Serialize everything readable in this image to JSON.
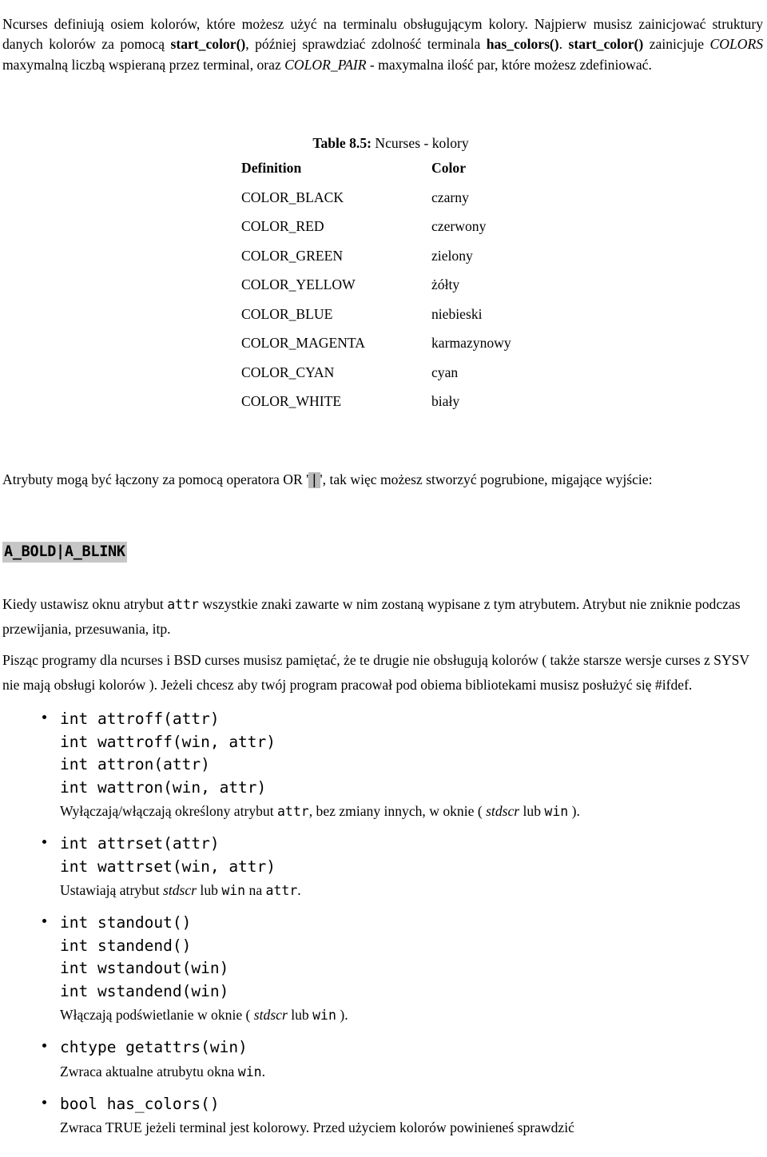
{
  "document": {
    "language": "pl",
    "intro": {
      "segments": [
        {
          "type": "text",
          "text": "Ncurses definiują osiem kolorów, które możesz użyć na terminalu obsługującym kolory. Najpierw musisz zainicjować struktury danych kolorów za pomocą "
        },
        {
          "type": "bold",
          "text": "start_color()"
        },
        {
          "type": "text",
          "text": ", później sprawdziać zdolność terminala "
        },
        {
          "type": "bold",
          "text": "has_colors()"
        },
        {
          "type": "text",
          "text": ". "
        },
        {
          "type": "bold",
          "text": "start_color()"
        },
        {
          "type": "text",
          "text": " zainicjuje "
        },
        {
          "type": "italic",
          "text": "COLORS"
        },
        {
          "type": "text",
          "text": " maxymalną liczbą wspieraną przez terminal, oraz "
        },
        {
          "type": "italic",
          "text": "COLOR_PAIR"
        },
        {
          "type": "text",
          "text": " - maxymalna ilość par, które możesz zdefiniować."
        }
      ],
      "plain": "Ncurses definiują osiem kolorów, które możesz użyć na terminalu obsługującym kolory. Najpierw musisz zainicjować struktury danych kolorów za pomocą start_color(), później sprawdziać zdolność terminala has_colors(). start_color() zainicjuje COLORS maxymalną liczbą wspieraną przez terminal, oraz COLOR_PAIR - maxymalna ilość par, które możesz zdefiniować."
    },
    "table": {
      "caption_label": "Table 8.5:",
      "caption_text": "Ncurses - kolory",
      "headers": {
        "definition": "Definition",
        "color": "Color"
      },
      "rows": [
        {
          "definition": "COLOR_BLACK",
          "color": "czarny"
        },
        {
          "definition": "COLOR_RED",
          "color": "czerwony"
        },
        {
          "definition": "COLOR_GREEN",
          "color": "zielony"
        },
        {
          "definition": "COLOR_YELLOW",
          "color": "żółty"
        },
        {
          "definition": "COLOR_BLUE",
          "color": "niebieski"
        },
        {
          "definition": "COLOR_MAGENTA",
          "color": "karmazynowy"
        },
        {
          "definition": "COLOR_CYAN",
          "color": "cyan"
        },
        {
          "definition": "COLOR_WHITE",
          "color": "biały"
        }
      ]
    },
    "or_paragraph": {
      "before": "Atrybuty mogą być łączony za pomocą operatora OR '",
      "pipe": "|",
      "after": "', tak więc możesz stworzyć pogrubione, migające wyjście:"
    },
    "code_block": {
      "text": "A_BOLD|A_BLINK",
      "background": "#c6c6c6"
    },
    "attr_paragraph": {
      "part1": "Kiedy ustawisz oknu atrybut ",
      "mono1": "attr",
      "part2": " wszystkie znaki zawarte w nim zostaną wypisane z tym atrybutem. Atrybut nie zniknie podczas przewijania, przesuwania, itp."
    },
    "bsd_paragraph": {
      "text": "Pisząc programy dla ncurses i BSD curses musisz pamiętać, że te drugie nie obsługują kolorów ( także starsze wersje curses z SYSV nie mają obsługi kolorów ). Jeżeli chcesz aby twój program pracował pod obiema bibliotekami musisz posłużyć się #ifdef."
    },
    "functions": [
      {
        "signature": "int attroff(attr)\nint wattroff(win, attr)\nint attron(attr)\nint wattron(win, attr)",
        "description": {
          "p1": "Wyłączają/włączają określony atrybut ",
          "m1": "attr",
          "p2": ", bez zmiany innych, w oknie ( ",
          "i1": "stdscr",
          "p3": " lub ",
          "m2": "win",
          "p4": " )."
        }
      },
      {
        "signature": "int attrset(attr)\nint wattrset(win, attr)",
        "description": {
          "p1": "Ustawiają atrybut ",
          "i1": "stdscr",
          "p2": " lub ",
          "m1": "win",
          "p3": " na ",
          "m2": "attr",
          "p4": "."
        }
      },
      {
        "signature": "int standout()\nint standend()\nint wstandout(win)\nint wstandend(win)",
        "description": {
          "p1": "Włączają podświetlanie w oknie ( ",
          "i1": "stdscr",
          "p2": " lub ",
          "m1": "win",
          "p3": " )."
        }
      },
      {
        "signature": "chtype getattrs(win)",
        "description": {
          "p1": "Zwraca aktualne atrubytu okna ",
          "m1": "win",
          "p2": "."
        }
      },
      {
        "signature": "bool has_colors()",
        "description": {
          "p1": "Zwraca TRUE jeżeli terminal jest kolorowy. Przed użyciem kolorów powinieneś sprawdzić",
          "m1": "",
          "p2": ""
        }
      }
    ]
  }
}
